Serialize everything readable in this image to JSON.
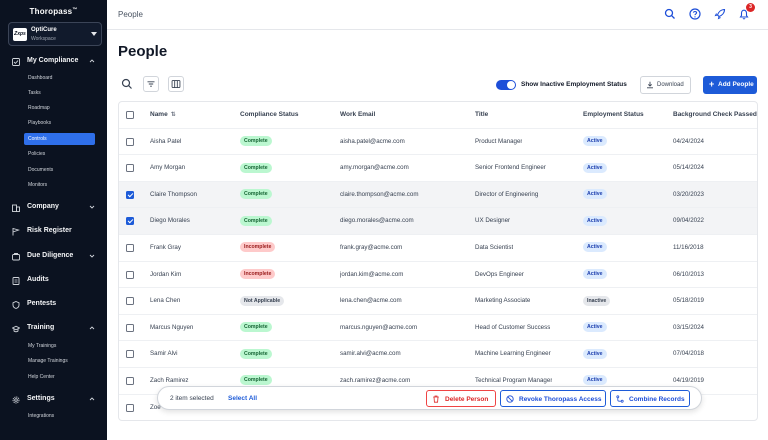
{
  "app": {
    "logo": "Thoropass",
    "logo_mark": "™"
  },
  "workspace": {
    "logo_text": "Zxps",
    "name": "OptiCure",
    "sub": "Workspace"
  },
  "sidebar": {
    "sections": [
      {
        "label": "My Compliance",
        "icon": "compliance-icon",
        "expanded": true
      },
      {
        "label": "Company",
        "icon": "building-icon",
        "expanded": false
      },
      {
        "label": "Risk Register",
        "icon": "flag-icon"
      },
      {
        "label": "Due Diligence",
        "icon": "diligence-icon",
        "expanded": false
      },
      {
        "label": "Audits",
        "icon": "audit-icon"
      },
      {
        "label": "Pentests",
        "icon": "shield-icon"
      },
      {
        "label": "Training",
        "icon": "graduation-icon",
        "expanded": true
      },
      {
        "label": "Settings",
        "icon": "gear-icon",
        "expanded": true
      }
    ],
    "compliance_items": [
      "Dashboard",
      "Tasks",
      "Roadmap",
      "Playbooks",
      "Controls",
      "Policies",
      "Documents",
      "Monitors"
    ],
    "training_items": [
      "My Trainings",
      "Manage Trainings",
      "Help Center"
    ],
    "settings_items": [
      "Integrations"
    ]
  },
  "topbar": {
    "breadcrumb": "People",
    "notification_count": "3"
  },
  "page": {
    "title": "People"
  },
  "toolbar": {
    "toggle_label": "Show Inactive Employment Status",
    "toggle_on": true,
    "download_label": "Download",
    "add_label": "Add People"
  },
  "table": {
    "columns": [
      "Name",
      "Compliance Status",
      "Work Email",
      "Title",
      "Employment Status",
      "Background Check Passed"
    ],
    "rows": [
      {
        "name": "Aisha Patel",
        "compliance": "Complete",
        "email": "aisha.patel@acme.com",
        "title": "Product Manager",
        "employment": "Active",
        "bg": "04/24/2024",
        "selected": false
      },
      {
        "name": "Amy Morgan",
        "compliance": "Complete",
        "email": "amy.morgan@acme.com",
        "title": "Senior Frontend Engineer",
        "employment": "Active",
        "bg": "05/14/2024",
        "selected": false
      },
      {
        "name": "Claire Thompson",
        "compliance": "Complete",
        "email": "claire.thompson@acme.com",
        "title": "Director of Engineering",
        "employment": "Active",
        "bg": "03/20/2023",
        "selected": true
      },
      {
        "name": "Diego Morales",
        "compliance": "Complete",
        "email": "diego.morales@acme.com",
        "title": "UX Designer",
        "employment": "Active",
        "bg": "09/04/2022",
        "selected": true
      },
      {
        "name": "Frank Gray",
        "compliance": "Incomplete",
        "email": "frank.gray@acme.com",
        "title": "Data Scientist",
        "employment": "Active",
        "bg": "11/16/2018",
        "selected": false
      },
      {
        "name": "Jordan Kim",
        "compliance": "Incomplete",
        "email": "jordan.kim@acme.com",
        "title": "DevOps Engineer",
        "employment": "Active",
        "bg": "06/10/2013",
        "selected": false
      },
      {
        "name": "Lena Chen",
        "compliance": "Not Applicable",
        "email": "lena.chen@acme.com",
        "title": "Marketing Associate",
        "employment": "Inactive",
        "bg": "05/18/2019",
        "selected": false
      },
      {
        "name": "Marcus Nguyen",
        "compliance": "Complete",
        "email": "marcus.nguyen@acme.com",
        "title": "Head of Customer Success",
        "employment": "Active",
        "bg": "03/15/2024",
        "selected": false
      },
      {
        "name": "Samir Alvi",
        "compliance": "Complete",
        "email": "samir.alvi@acme.com",
        "title": "Machine Learning Engineer",
        "employment": "Active",
        "bg": "07/04/2018",
        "selected": false
      },
      {
        "name": "Zach Ramirez",
        "compliance": "Complete",
        "email": "zach.ramirez@acme.com",
        "title": "Technical Program Manager",
        "employment": "Active",
        "bg": "04/19/2019",
        "selected": false
      },
      {
        "name": "Zoe",
        "compliance": "",
        "email": "",
        "title": "",
        "employment": "",
        "bg": "",
        "selected": false
      }
    ]
  },
  "selection_bar": {
    "count_text": "2 item selected",
    "select_all": "Select All",
    "delete_label": "Delete Person",
    "revoke_label": "Revoke Thoropass Access",
    "combine_label": "Combine Records"
  },
  "colors": {
    "sidebar_bg": "#0b1220",
    "accent": "#1d5bd8",
    "complete": "#bbf7d0",
    "incomplete": "#fecaca",
    "danger": "#dc2626"
  }
}
